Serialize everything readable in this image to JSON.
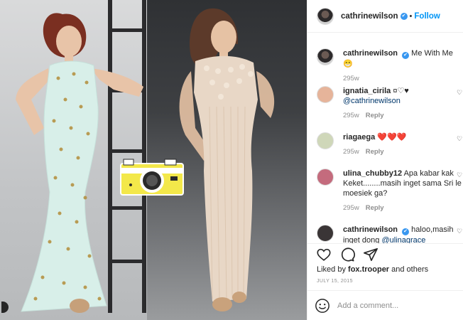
{
  "post": {
    "author": "cathrinewilson",
    "follow_label": "Follow",
    "dot": "•",
    "verified_mark": "✔",
    "caption": "Me With Me😁",
    "caption_time": "295w"
  },
  "photo": {
    "left_dress_color": "#d8efe9",
    "right_dress_color": "#e8d7c6",
    "camera_color": "#f3e84a",
    "icon": "camera-sticker-icon"
  },
  "comments": [
    {
      "user": "ignatia_cirila",
      "text": "¤♡♥",
      "mention": "@cathrinewilson",
      "time": "295w",
      "reply": "Reply",
      "avatar_color": "#e6b49a"
    },
    {
      "user": "riagaega",
      "text": "❤️❤️❤️",
      "mention": "",
      "time": "295w",
      "reply": "Reply",
      "avatar_color": "#cfd7b9"
    },
    {
      "user": "ulina_chubby12",
      "text": "Apa kabar kak Keket........masih inget sama Sri le moesiek ga?",
      "mention": "",
      "time": "295w",
      "reply": "Reply",
      "avatar_color": "#c46b7d"
    },
    {
      "user": "cathrinewilson",
      "text": "haloo,masih inget dong ",
      "mention": "@ulinagrace",
      "time": "",
      "reply": "",
      "avatar_color": "#3a3536"
    }
  ],
  "actions": {
    "like_icon": "heart-icon",
    "comment_icon": "comment-icon",
    "share_icon": "share-icon",
    "liked_by_prefix": "Liked by ",
    "liked_by_user": "fox.trooper",
    "liked_by_suffix": " and others",
    "date": "JULY 15, 2015"
  },
  "add_comment": {
    "placeholder": "Add a comment..."
  }
}
